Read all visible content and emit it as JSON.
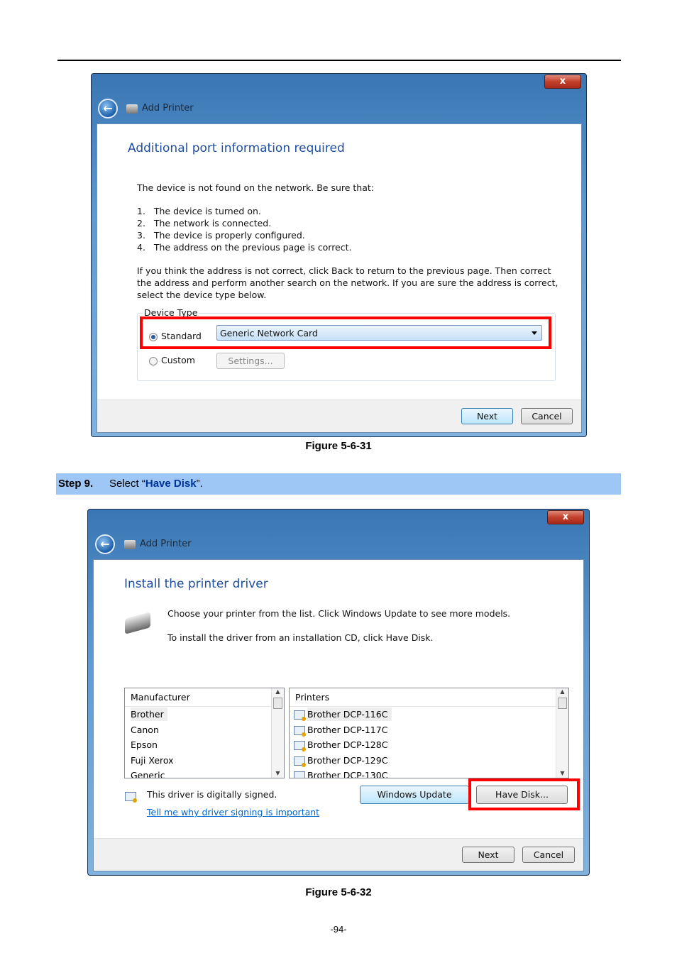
{
  "figure1": {
    "window_title": "Add Printer",
    "close_label": "x",
    "heading": "Additional port information required",
    "intro": "The device is not found on the network.  Be sure that:",
    "checklist": [
      "1.   The device is turned on.",
      "2.   The network is connected.",
      "3.   The device is properly configured.",
      "4.   The address on the previous page is correct."
    ],
    "paragraph": "If you think the address is not correct, click Back to return to the previous page.  Then correct the address and perform another search on the network.  If you are sure the address is correct, select the device type below.",
    "group_label": "Device Type",
    "standard_label": "Standard",
    "standard_selected": true,
    "dropdown_value": "Generic Network Card",
    "custom_label": "Custom",
    "settings_label": "Settings...",
    "next_label": "Next",
    "cancel_label": "Cancel",
    "caption": "Figure 5-6-31"
  },
  "step": {
    "label": "Step 9.",
    "text_before": "Select “",
    "highlight": "Have Disk",
    "text_after": "”.",
    "highlight_color": "#003399",
    "bar_color": "#9ec7f5"
  },
  "figure2": {
    "window_title": "Add Printer",
    "close_label": "x",
    "heading": "Install the printer driver",
    "line1": "Choose your printer from the list. Click Windows Update to see more models.",
    "line2": "To install the driver from an installation CD, click Have Disk.",
    "manufacturer_header": "Manufacturer",
    "manufacturers": [
      "Brother",
      "Canon",
      "Epson",
      "Fuji Xerox",
      "Generic"
    ],
    "printers_header": "Printers",
    "printers": [
      "Brother DCP-116C",
      "Brother DCP-117C",
      "Brother DCP-128C",
      "Brother DCP-129C",
      "Brother DCP-130C"
    ],
    "signed_text": "This driver is digitally signed.",
    "signing_link": "Tell me why driver signing is important",
    "windows_update_label": "Windows Update",
    "have_disk_label": "Have Disk...",
    "next_label": "Next",
    "cancel_label": "Cancel",
    "caption": "Figure 5-6-32"
  },
  "page_number": "-94-"
}
